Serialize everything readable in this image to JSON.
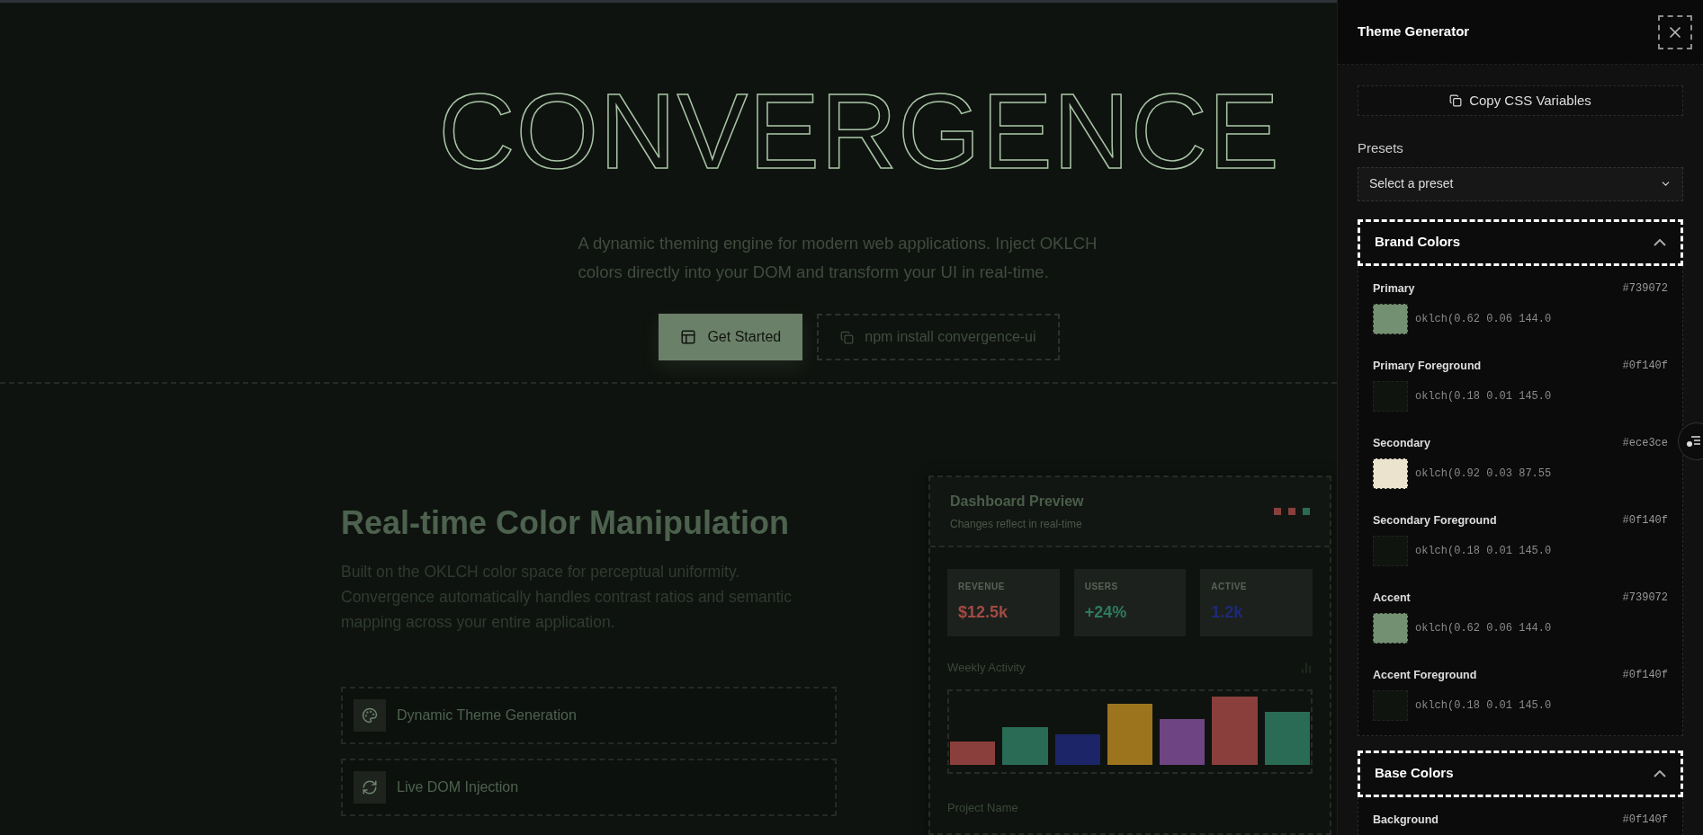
{
  "hero": {
    "title": "CONVERGENCE",
    "subtitle": "A dynamic theming engine for modern web applications. Inject OKLCH colors directly into your DOM and transform your UI in real-time.",
    "primary_button": "Get Started",
    "install_button": "npm install convergence-ui"
  },
  "feature_section": {
    "heading": "Real-time Color Manipulation",
    "paragraph": "Built on the OKLCH color space for perceptual uniformity. Convergence automatically handles contrast ratios and semantic mapping across your entire application.",
    "features": [
      {
        "kind": "palette",
        "label": "Dynamic Theme Generation"
      },
      {
        "kind": "refresh",
        "label": "Live DOM Injection"
      }
    ]
  },
  "dashboard": {
    "title": "Dashboard Preview",
    "subtitle": "Changes reflect in real-time",
    "dots": [
      {
        "color": "#8a3f3c"
      },
      {
        "color": "#8a3f3c"
      },
      {
        "color": "#2a6b55"
      }
    ],
    "stats": [
      {
        "label": "REVENUE",
        "value": "$12.5k",
        "color": "#a14a44"
      },
      {
        "label": "USERS",
        "value": "+24%",
        "color": "#2e7a5e"
      },
      {
        "label": "ACTIVE",
        "value": "1.2k",
        "color": "#1e2a78"
      }
    ],
    "activity_label": "Weekly Activity",
    "field_label": "Project Name"
  },
  "panel": {
    "title": "Theme Generator",
    "copy_button": "Copy CSS Variables",
    "presets_label": "Presets",
    "preset_placeholder": "Select a preset",
    "sections": [
      {
        "title": "Brand Colors",
        "expanded": true,
        "items": [
          {
            "name": "Primary",
            "hex": "#739072",
            "oklch": "oklch(0.62 0.06 144.0",
            "color": "#739072"
          },
          {
            "name": "Primary Foreground",
            "hex": "#0f140f",
            "oklch": "oklch(0.18 0.01 145.0",
            "color": "#0f140f"
          },
          {
            "name": "Secondary",
            "hex": "#ece3ce",
            "oklch": "oklch(0.92 0.03 87.55",
            "color": "#ece3ce"
          },
          {
            "name": "Secondary Foreground",
            "hex": "#0f140f",
            "oklch": "oklch(0.18 0.01 145.0",
            "color": "#0f140f"
          },
          {
            "name": "Accent",
            "hex": "#739072",
            "oklch": "oklch(0.62 0.06 144.0",
            "color": "#739072"
          },
          {
            "name": "Accent Foreground",
            "hex": "#0f140f",
            "oklch": "oklch(0.18 0.01 145.0",
            "color": "#0f140f"
          }
        ]
      },
      {
        "title": "Base Colors",
        "expanded": true,
        "items": [
          {
            "name": "Background",
            "hex": "#0f140f"
          }
        ]
      }
    ]
  }
}
